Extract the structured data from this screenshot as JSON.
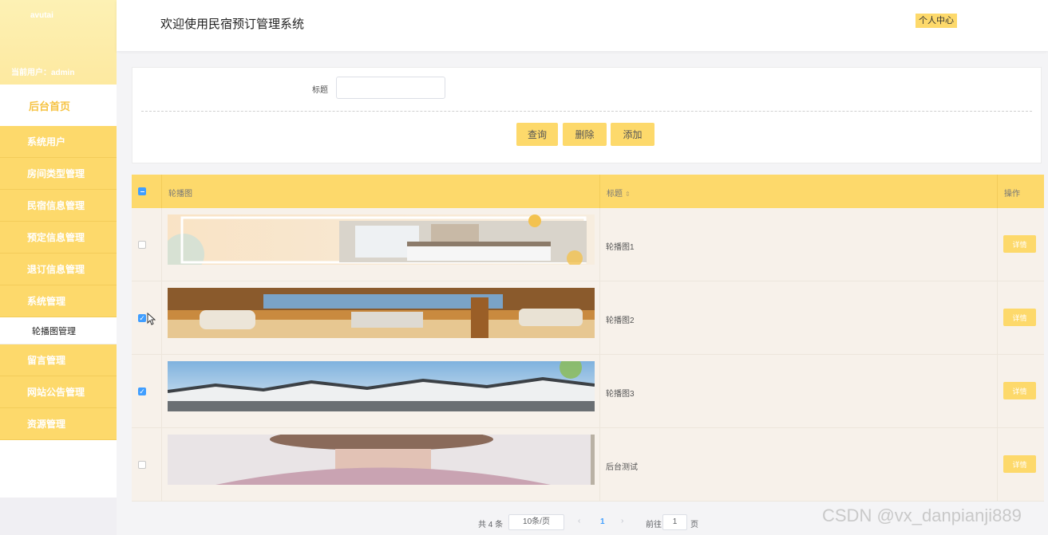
{
  "sidebar": {
    "brand": "avutai",
    "current_user": "当前用户：admin",
    "home": "后台首页",
    "items": [
      {
        "label": "系统用户"
      },
      {
        "label": "房间类型管理"
      },
      {
        "label": "民宿信息管理"
      },
      {
        "label": "预定信息管理"
      },
      {
        "label": "退订信息管理"
      },
      {
        "label": "系统管理"
      }
    ],
    "sub_item": "轮播图管理",
    "items_after": [
      {
        "label": "留言管理"
      },
      {
        "label": "网站公告管理"
      },
      {
        "label": "资源管理"
      }
    ]
  },
  "header": {
    "title": "欢迎使用民宿预订管理系统",
    "profile_button": "个人中心"
  },
  "search": {
    "title_label": "标题",
    "title_value": "",
    "query_button": "查询",
    "delete_button": "删除",
    "add_button": "添加"
  },
  "table": {
    "columns": [
      "轮播图",
      "标题",
      "操作"
    ],
    "rows": [
      {
        "title": "轮播图1",
        "checked": false,
        "action": "详情",
        "image": "bedroom-banner"
      },
      {
        "title": "轮播图2",
        "checked": true,
        "action": "详情",
        "image": "lounge-banner"
      },
      {
        "title": "轮播图3",
        "checked": true,
        "action": "详情",
        "image": "village-banner"
      },
      {
        "title": "后台测试",
        "checked": false,
        "action": "详情",
        "image": "portrait-banner"
      }
    ]
  },
  "pagination": {
    "total": "共 4 条",
    "page_size": "10条/页",
    "current_page": "1",
    "goto_label": "前往",
    "goto_value": "1",
    "page_suffix": "页"
  },
  "watermark": "CSDN @vx_danpianji889",
  "colors": {
    "accent": "#fdd96b",
    "row_bg": "#f7f1ea",
    "checkbox": "#409eff"
  }
}
